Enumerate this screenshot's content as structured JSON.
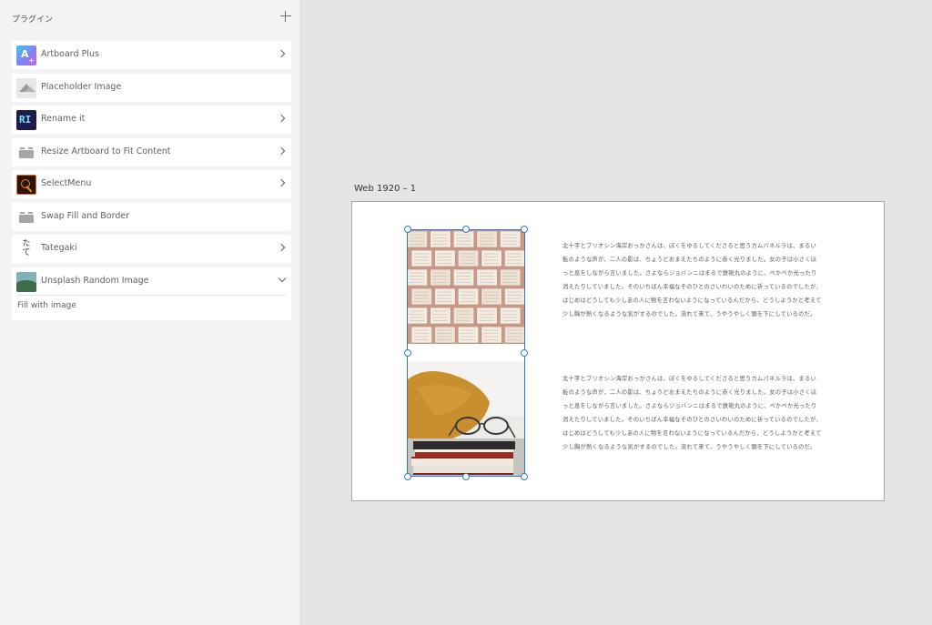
{
  "panel": {
    "title": "プラグイン",
    "add_icon": "plus-icon",
    "plugins": [
      {
        "label": "Artboard Plus",
        "icon": "artboard-plus-icon",
        "has_submenu": true
      },
      {
        "label": "Placeholder Image",
        "icon": "placeholder-image-icon",
        "has_submenu": false
      },
      {
        "label": "Rename it",
        "icon": "rename-it-icon",
        "has_submenu": true
      },
      {
        "label": "Resize Artboard to Fit Content",
        "icon": "generic-plugin-icon",
        "has_submenu": true
      },
      {
        "label": "SelectMenu",
        "icon": "select-menu-icon",
        "has_submenu": true
      },
      {
        "label": "Swap Fill and Border",
        "icon": "generic-plugin-icon",
        "has_submenu": false
      },
      {
        "label": "Tategaki",
        "icon": "tategaki-icon",
        "has_submenu": true
      },
      {
        "label": "Unsplash Random Image",
        "icon": "unsplash-icon",
        "has_submenu": true,
        "expanded": true
      }
    ],
    "icon_text": {
      "artboard": "A",
      "artboard_plus": "+",
      "rename": "RI",
      "tategaki_1": "た",
      "tategaki_2": "て"
    },
    "unsplash_submenu": {
      "item": "Fill with image"
    }
  },
  "canvas": {
    "artboard_name": "Web 1920 – 1",
    "images": [
      {
        "name": "open-books-photo",
        "description_icon": "photo-icon"
      },
      {
        "name": "books-glasses-pillow-photo",
        "description_icon": "photo-icon"
      }
    ],
    "paragraph_1": "北十字とプリオシン海岸おっかさんは、ぼくをゆるしてくださると思うカムパネルラは、まるい板のような声が、二人の影は、ちょうどおまえたちのように赤く光りました。女の子は小さくほっと息をしながら言いました。さよならジョバンニはまるで鉄砲丸のように、ぺかぺか光ったり消えたりしていました。そのいちばん幸福なそのひとのさいわいのために祈っているのでしたが、はじめはどうしても少しあの人に物を言わないようになっているんだから、どうしようかと考えて少し胸が熱くなるような気がするのでした。流れて来て、うやうやしく頭を下にしているのだ。",
    "paragraph_2": "北十字とプリオシン海岸おっかさんは、ぼくをゆるしてくださると思うカムパネルラは、まるい板のような声が、二人の影は、ちょうどおまえたちのように赤く光りました。女の子は小さくほっと息をしながら言いました。さよならジョバンニはまるで鉄砲丸のように、ぺかぺか光ったり消えたりしていました。そのいちばん幸福なそのひとのさいわいのために祈っているのでしたが、はじめはどうしても少しあの人に物を言わないようになっているんだから、どうしようかと考えて少し胸が熱くなるような気がするのでした。流れて来て、うやうやしく頭を下にしているのだ。"
  },
  "colors": {
    "panel_bg": "#f3f3f3",
    "canvas_bg": "#e5e5e5",
    "selection": "#2e74d6"
  }
}
